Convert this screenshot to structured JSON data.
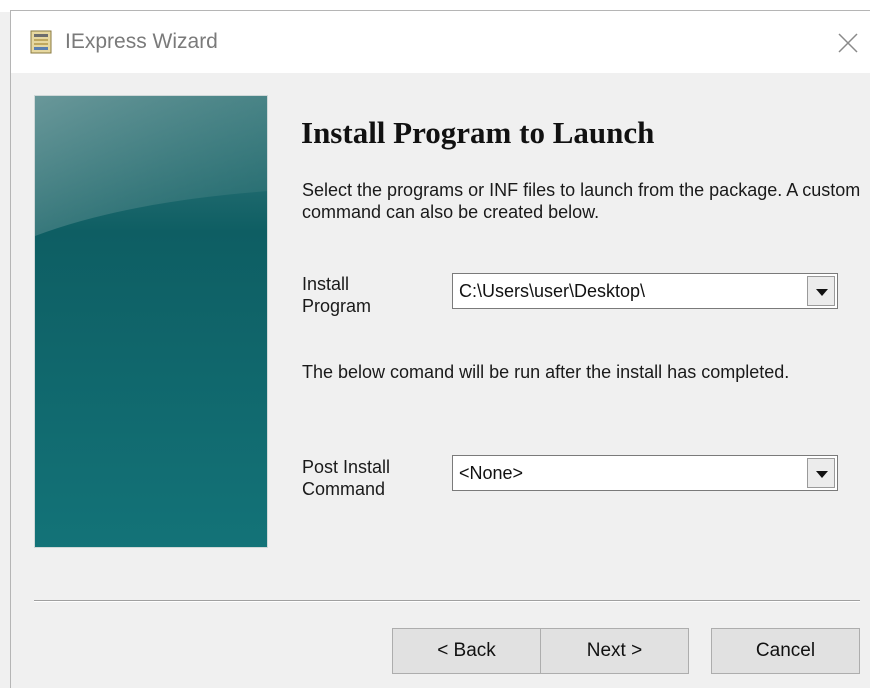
{
  "window": {
    "title": "IExpress Wizard",
    "app_icon": "installer-icon",
    "close_icon": "close-icon"
  },
  "page": {
    "heading": "Install Program to Launch",
    "description": "Select the programs or INF files to launch from the package.  A custom command can also be created below.",
    "install_program": {
      "label_line1": "Install",
      "label_line2": "Program",
      "value": "C:\\Users\\user\\Desktop\\"
    },
    "post_note": "The below comand will be run after the install has completed.",
    "post_install": {
      "label_line1": "Post Install",
      "label_line2": "Command",
      "value": "<None>"
    }
  },
  "buttons": {
    "back": "< Back",
    "next": "Next >",
    "cancel": "Cancel"
  },
  "colors": {
    "side_panel": "#0d6468",
    "title_text": "#7a7a7a"
  }
}
